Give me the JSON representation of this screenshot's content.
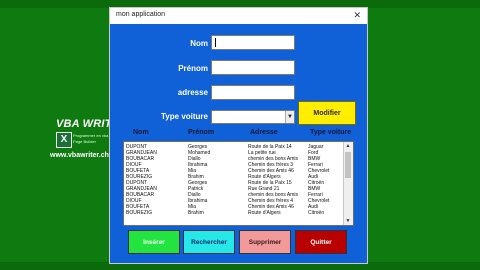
{
  "window": {
    "title": "mon application",
    "close_glyph": "✕"
  },
  "form": {
    "nom_label": "Nom",
    "prenom_label": "Prénom",
    "adresse_label": "adresse",
    "type_label": "Type voiture",
    "nom_value": "",
    "prenom_value": "",
    "adresse_value": "",
    "type_value": "",
    "modifier_label": "Modifier"
  },
  "list": {
    "headers": [
      "Nom",
      "Prénom",
      "Adresse",
      "Type voiture"
    ],
    "rows": [
      [
        "DUPONT",
        "Georges",
        "Route de la Paix 14",
        "Jaguar"
      ],
      [
        "GRANDJEAN",
        "Mohamed",
        "La petite rue",
        "Ford"
      ],
      [
        "BOUBACAR",
        "Diallo",
        "chemin des bons Amis",
        "BMW"
      ],
      [
        "DIOUF",
        "Ibrahima",
        "Chemin des frères 3",
        "Ferrari"
      ],
      [
        "BOUFETA",
        "Mia",
        "Chemin des Amis 46",
        "Chevrolet"
      ],
      [
        "BOUREZIG",
        "Brahim",
        "Route d'Algers",
        "Audi"
      ],
      [
        "DUPONT",
        "Georges",
        "Route de la Paix 15",
        "Citroën"
      ],
      [
        "GRANDJEAN",
        "Patrick",
        "Rue Grand 21",
        "BMW"
      ],
      [
        "BOUBACAR",
        "Diallo",
        "chemin des bons Amis",
        "Ferrari"
      ],
      [
        "DIOUF",
        "Ibrahima",
        "Chemin des frères 4",
        "Chevrolet"
      ],
      [
        "BOUFETA",
        "Mia",
        "Chemin des Amis 46",
        "Audi"
      ],
      [
        "BOUREZIG",
        "Brahim",
        "Route d'Algers",
        "Citroën"
      ]
    ]
  },
  "actions": {
    "inserer": "Insérer",
    "rechercher": "Rechercher",
    "supprimer": "Supprimer",
    "quitter": "Quitter"
  },
  "logo": {
    "name": "VBA WRITER",
    "tag1": "Programmer en vba",
    "tag2": "Page Builder",
    "site": "www.vbawriter.ch",
    "icon_letter": "X"
  },
  "colors": {
    "background": "#0f7a10",
    "window": "#1060d8",
    "modifier": "#ffee00",
    "inserer": "#22e340",
    "rechercher": "#27e8e8",
    "supprimer": "#f29a9a",
    "quitter": "#b80000"
  }
}
